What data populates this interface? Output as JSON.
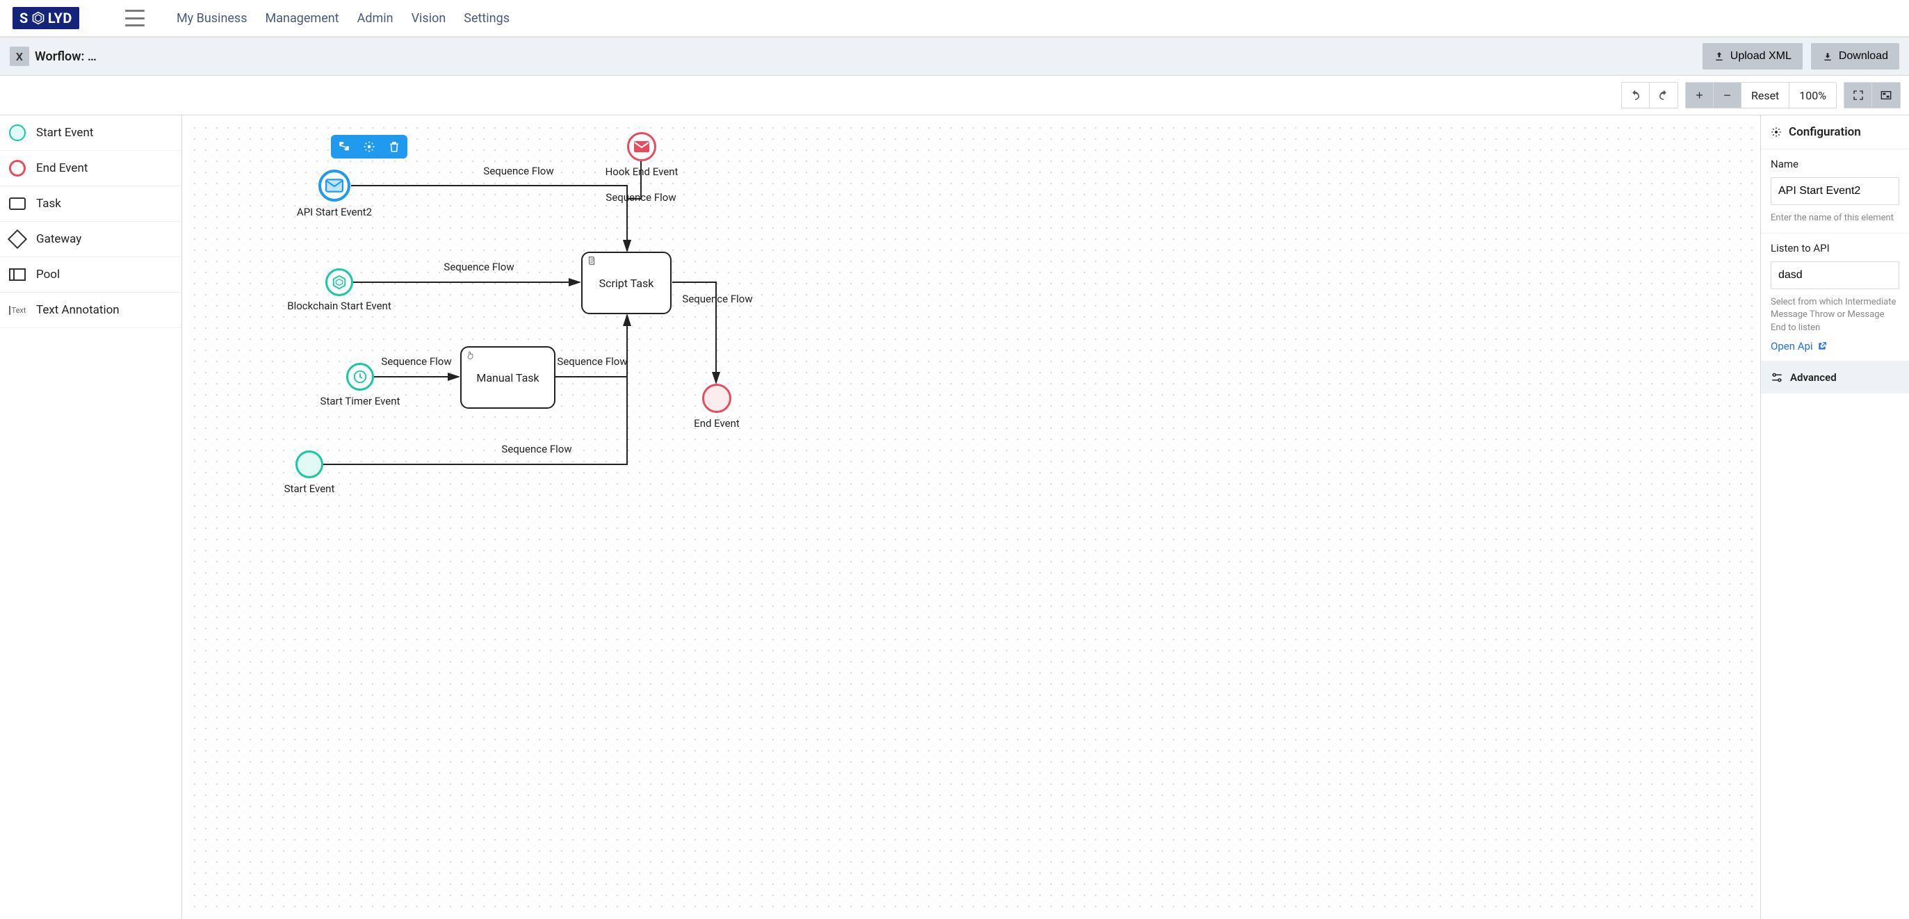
{
  "brand": "SOLYD",
  "nav": {
    "items": [
      "My Business",
      "Management",
      "Admin",
      "Vision",
      "Settings"
    ]
  },
  "subheader": {
    "tab_title": "Worflow: …",
    "upload_label": "Upload XML",
    "download_label": "Download"
  },
  "toolbar": {
    "reset_label": "Reset",
    "zoom_label": "100%"
  },
  "palette": {
    "items": [
      {
        "label": "Start Event",
        "icon": "start"
      },
      {
        "label": "End Event",
        "icon": "end"
      },
      {
        "label": "Task",
        "icon": "task"
      },
      {
        "label": "Gateway",
        "icon": "gateway"
      },
      {
        "label": "Pool",
        "icon": "pool"
      },
      {
        "label": "Text Annotation",
        "icon": "annotation"
      }
    ]
  },
  "diagram": {
    "nodes": {
      "api_start": {
        "label": "API Start Event2"
      },
      "blockchain_start": {
        "label": "Blockchain Start Event"
      },
      "timer_start": {
        "label": "Start Timer Event"
      },
      "plain_start": {
        "label": "Start Event"
      },
      "hook_end": {
        "label": "Hook End Event"
      },
      "end_event": {
        "label": "End Event"
      },
      "script_task": {
        "label": "Script Task"
      },
      "manual_task": {
        "label": "Manual Task"
      }
    },
    "edges": {
      "e1": "Sequence Flow",
      "e2": "Sequence Flow",
      "e3": "Sequence Flow",
      "e4": "Sequence Flow",
      "e5": "Sequence Flow",
      "e6": "Sequence Flow",
      "e7": "Sequence Flow"
    }
  },
  "config": {
    "title": "Configuration",
    "name_label": "Name",
    "name_value": "API Start Event2",
    "name_helper": "Enter the name of this element",
    "listen_label": "Listen to API",
    "listen_value": "dasd",
    "listen_helper": "Select from which Intermediate Message Throw or Message End to listen",
    "open_api": "Open Api",
    "advanced": "Advanced"
  }
}
